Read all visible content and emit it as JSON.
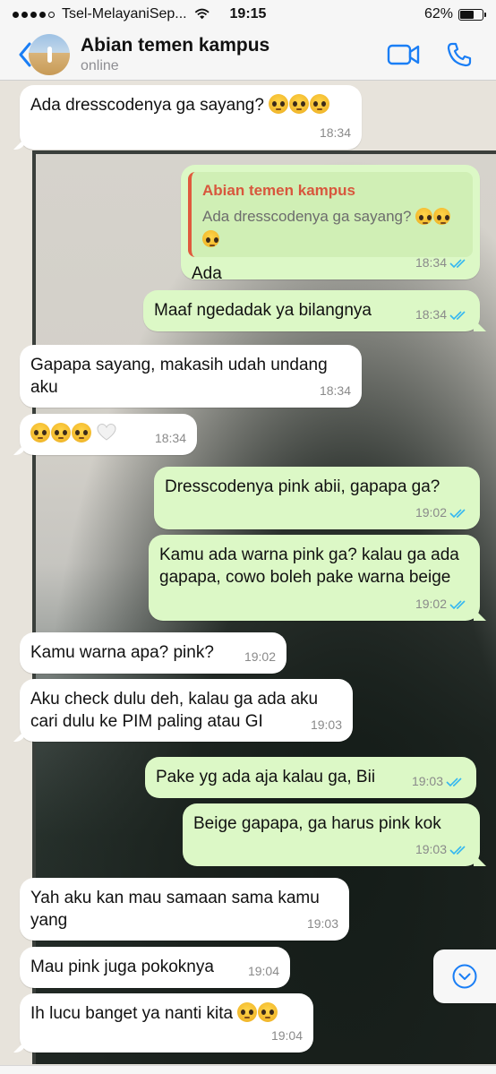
{
  "status_bar": {
    "carrier": "Tsel-MelayaniSep...",
    "time": "19:15",
    "battery": "62%",
    "battery_level": 0.62
  },
  "header": {
    "contact_name": "Abian temen kampus",
    "status": "online"
  },
  "messages": [
    {
      "dir": "in",
      "text": "Ada dresscodenya ga sayang?",
      "emoji_count": 3,
      "time": "18:34"
    },
    {
      "dir": "out",
      "quote_name": "Abian temen kampus",
      "quote_text": "Ada dresscodenya ga sayang?",
      "quote_emoji": 3,
      "text": "Ada",
      "time": "18:34",
      "read": true
    },
    {
      "dir": "out",
      "text": "Maaf ngedadak ya bilangnya",
      "time": "18:34",
      "read": true
    },
    {
      "dir": "in",
      "text": "Gapapa sayang, makasih udah undang aku",
      "time": "18:34"
    },
    {
      "dir": "in",
      "text": "",
      "emoji_count": 3,
      "heart": true,
      "time": "18:34"
    },
    {
      "dir": "out",
      "text": "Dresscodenya pink abii, gapapa ga?",
      "time": "19:02",
      "read": true
    },
    {
      "dir": "out",
      "text": "Kamu ada warna pink ga? kalau ga ada gapapa, cowo boleh pake warna beige",
      "time": "19:02",
      "read": true
    },
    {
      "dir": "in",
      "text": "Kamu warna apa? pink?",
      "time": "19:02"
    },
    {
      "dir": "in",
      "text": "Aku check dulu deh, kalau ga ada aku cari dulu ke PIM paling atau GI",
      "time": "19:03"
    },
    {
      "dir": "out",
      "text": "Pake yg ada aja kalau ga, Bii",
      "time": "19:03",
      "read": true
    },
    {
      "dir": "out",
      "text": "Beige gapapa, ga harus pink kok",
      "time": "19:03",
      "read": true
    },
    {
      "dir": "in",
      "text": "Yah aku kan mau samaan sama kamu yang",
      "time": "19:03"
    },
    {
      "dir": "in",
      "text": "Mau pink juga pokoknya",
      "time": "19:04"
    },
    {
      "dir": "in",
      "text": "Ih lucu banget ya nanti kita",
      "emoji_count": 2,
      "time": "19:04"
    }
  ],
  "colors": {
    "accent": "#1a7ef5",
    "outgoing_bubble": "#dcf8c6",
    "incoming_bubble": "#ffffff",
    "read_ticks": "#34b7f1",
    "quote_name": "#d8573d"
  }
}
